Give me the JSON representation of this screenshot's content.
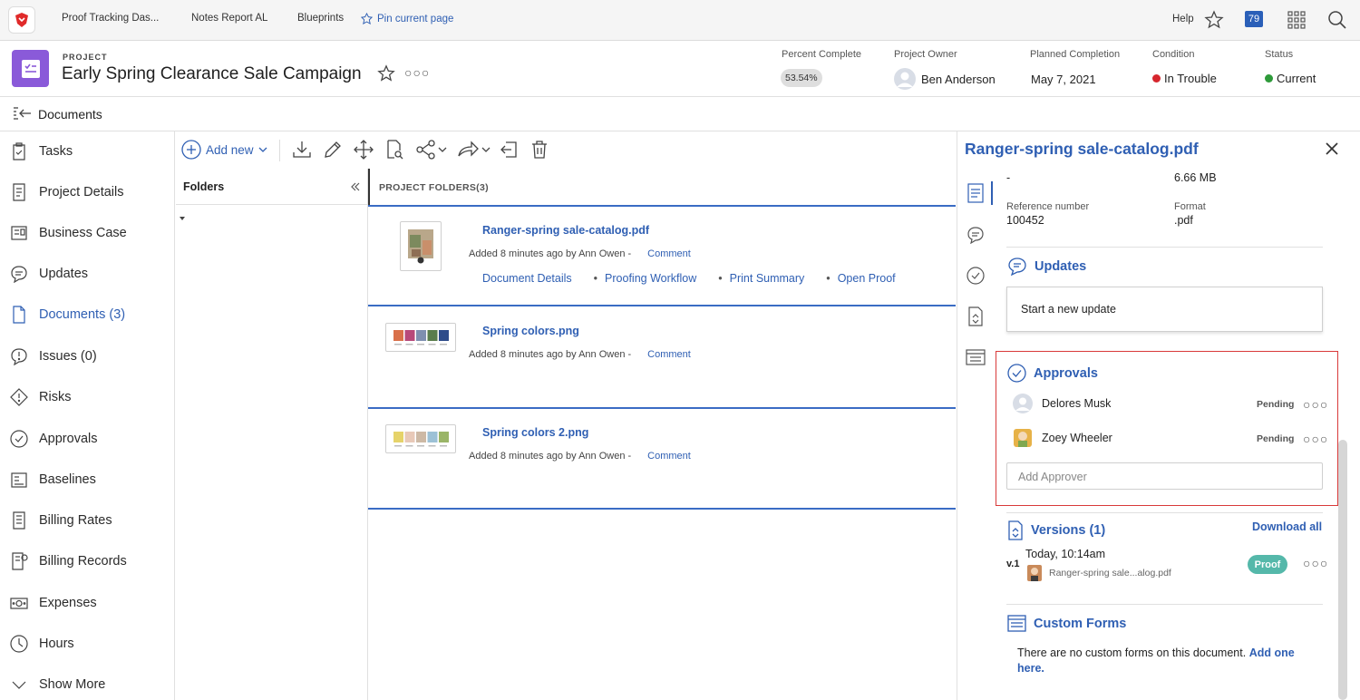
{
  "topbar": {
    "tabs": [
      "Proof Tracking Das...",
      "Notes Report AL",
      "Blueprints"
    ],
    "pin_label": "Pin current page",
    "help_label": "Help",
    "notification_count": "79"
  },
  "project": {
    "type_label": "PROJECT",
    "title": "Early Spring Clearance Sale Campaign",
    "meta": {
      "percent_complete_label": "Percent Complete",
      "percent_complete": "53.54%",
      "owner_label": "Project Owner",
      "owner": "Ben Anderson",
      "planned_completion_label": "Planned Completion",
      "planned_completion": "May 7, 2021",
      "condition_label": "Condition",
      "condition": "In Trouble",
      "condition_color": "#d6262d",
      "status_label": "Status",
      "status": "Current",
      "status_color": "#2e9a3a"
    }
  },
  "documents_bar": {
    "title": "Documents"
  },
  "nav": {
    "items": [
      {
        "label": "Tasks",
        "icon": "tasks-icon"
      },
      {
        "label": "Project Details",
        "icon": "document-icon"
      },
      {
        "label": "Business Case",
        "icon": "business-case-icon"
      },
      {
        "label": "Updates",
        "icon": "chat-bubble-icon"
      },
      {
        "label": "Documents (3)",
        "icon": "file-icon"
      },
      {
        "label": "Issues (0)",
        "icon": "issue-icon"
      },
      {
        "label": "Risks",
        "icon": "risk-diamond-icon"
      },
      {
        "label": "Approvals",
        "icon": "check-circle-icon"
      },
      {
        "label": "Baselines",
        "icon": "baseline-icon"
      },
      {
        "label": "Billing Rates",
        "icon": "billing-rates-icon"
      },
      {
        "label": "Billing Records",
        "icon": "billing-records-icon"
      },
      {
        "label": "Expenses",
        "icon": "money-icon"
      },
      {
        "label": "Hours",
        "icon": "clock-icon"
      },
      {
        "label": "Show More",
        "icon": "chevron-down-icon"
      }
    ]
  },
  "toolbar": {
    "add_new_label": "Add new"
  },
  "folders": {
    "label": "Folders"
  },
  "doclist": {
    "header": "PROJECT FOLDERS(3)",
    "docs": [
      {
        "name": "Ranger-spring sale-catalog.pdf",
        "meta": "Added 8 minutes ago by Ann Owen -",
        "comment": "Comment",
        "links": [
          "Document Details",
          "Proofing Workflow",
          "Print Summary",
          "Open Proof"
        ]
      },
      {
        "name": "Spring colors.png",
        "meta": "Added 8 minutes ago by Ann Owen -",
        "comment": "Comment",
        "swatches": [
          "#d9704a",
          "#b8497a",
          "#7f8fb0",
          "#5a7d4c",
          "#2e4c8a"
        ]
      },
      {
        "name": "Spring colors 2.png",
        "meta": "Added 8 minutes ago by Ann Owen -",
        "comment": "Comment",
        "swatches": [
          "#e6d36a",
          "#e8c9b8",
          "#cdb9a5",
          "#9cc1d6",
          "#9ab567"
        ]
      }
    ]
  },
  "panel": {
    "title": "Ranger-spring sale-catalog.pdf",
    "size_dash": "-",
    "size": "6.66 MB",
    "reference_label": "Reference number",
    "reference": "100452",
    "format_label": "Format",
    "format": ".pdf",
    "updates": {
      "title": "Updates",
      "placeholder": "Start a new update"
    },
    "approvals": {
      "title": "Approvals",
      "approvers": [
        {
          "name": "Delores Musk",
          "status": "Pending"
        },
        {
          "name": "Zoey Wheeler",
          "status": "Pending"
        }
      ],
      "add_placeholder": "Add Approver"
    },
    "versions": {
      "title": "Versions (1)",
      "download_all": "Download all",
      "version_label": "v.1",
      "version_time": "Today, 10:14am",
      "version_file": "Ranger-spring sale...alog.pdf",
      "proof_label": "Proof"
    },
    "custom_forms": {
      "title": "Custom Forms",
      "text": "There are no custom forms on this document.",
      "link_part1": "Add one",
      "link_part2": "here."
    }
  }
}
